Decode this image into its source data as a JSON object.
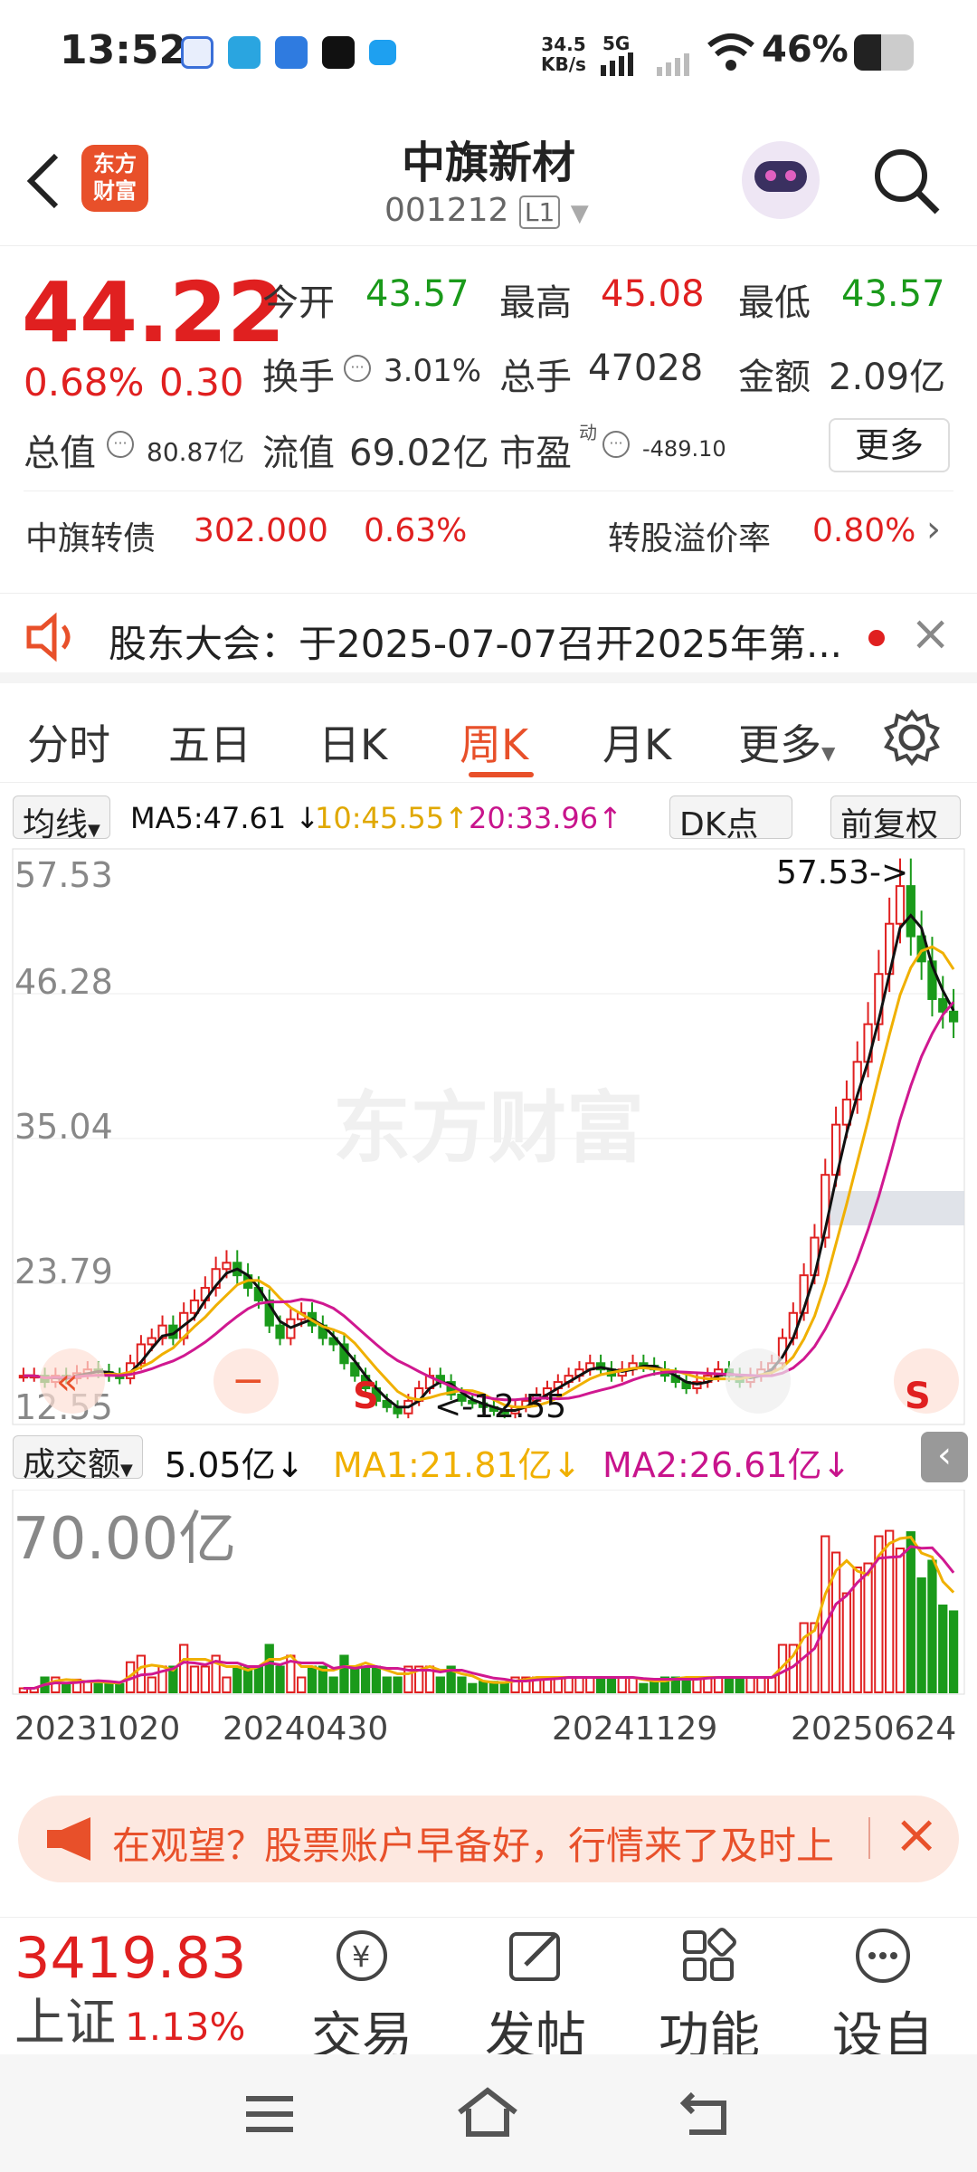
{
  "status": {
    "time": "13:52",
    "net_speed": "34.5",
    "net_unit": "KB/s",
    "net_type": "5G",
    "battery": "46%"
  },
  "header": {
    "title": "中旗新材",
    "code": "001212",
    "level": "L1",
    "logo_text": "东方\n财富"
  },
  "quote": {
    "price": "44.22",
    "change_pct": "0.68%",
    "change": "0.30",
    "open_label": "今开",
    "open": "43.57",
    "high_label": "最高",
    "high": "45.08",
    "low_label": "最低",
    "low": "43.57",
    "turnover_label": "换手",
    "turnover": "3.01%",
    "volume_label": "总手",
    "volume": "47028",
    "amount_label": "金额",
    "amount": "2.09亿",
    "mktcap_label": "总值",
    "mktcap": "80.87亿",
    "float_label": "流值",
    "float": "69.02亿",
    "pe_label": "市盈",
    "pe_sup": "动",
    "pe": "-489.10",
    "more_button": "更多",
    "bond_label": "中旗转债",
    "bond_price": "302.000",
    "bond_pct": "0.63%",
    "premium_label": "转股溢价率",
    "premium": "0.80%"
  },
  "notice": {
    "text": "股东大会：于2025-07-07召开2025年第..."
  },
  "tabs": [
    "分时",
    "五日",
    "日K",
    "周K",
    "月K",
    "更多"
  ],
  "chart_toolbar": {
    "ma_select": "均线",
    "ma5": "MA5:47.61",
    "ma5_arrow": "↓",
    "ma10": "10:45.55",
    "ma10_arrow": "↑",
    "ma20": "20:33.96",
    "ma20_arrow": "↑",
    "dk": "DK点",
    "adjust": "前复权"
  },
  "chart_data": {
    "type": "candlestick",
    "ylim": [
      12.55,
      57.53
    ],
    "y_ticks": [
      "57.53",
      "46.28",
      "35.04",
      "23.79",
      "12.55"
    ],
    "annotation_high": "57.53->",
    "annotation_low": "<-12.55",
    "watermark": "东方财富",
    "ma_colors": {
      "ma5": "#111111",
      "ma10": "#f0b000",
      "ma20": "#d01890"
    },
    "closes": [
      16,
      16,
      15.5,
      16,
      15.8,
      16.2,
      16.5,
      16.3,
      16,
      15.8,
      17,
      18.5,
      19,
      20,
      19,
      21,
      22,
      23,
      24.5,
      25,
      24,
      23,
      22,
      20,
      19,
      20.5,
      21,
      20,
      19,
      18.5,
      17,
      16,
      15,
      14,
      13.5,
      13,
      14,
      15,
      16,
      15.5,
      14.5,
      14,
      13.8,
      13.5,
      13.2,
      13,
      13.5,
      14,
      14.5,
      15,
      15.5,
      16,
      16.5,
      17,
      16.5,
      16,
      16.5,
      17,
      16.8,
      16.5,
      16,
      15.5,
      15,
      15.5,
      16,
      16.5,
      16,
      15.5,
      16,
      16.5,
      17,
      19,
      21,
      24,
      27,
      32,
      36,
      38,
      41,
      44,
      48,
      52,
      55,
      51,
      49,
      46,
      45,
      44.22
    ]
  },
  "volume": {
    "label": "成交额",
    "value": "5.05亿",
    "arrow": "↓",
    "ma1": "MA1:21.81亿",
    "ma1_arrow": "↓",
    "ma2": "MA2:26.61亿",
    "ma2_arrow": "↓",
    "ymax": "70.00亿",
    "dates": [
      "20231020",
      "20240430",
      "20241129",
      "20250624"
    ]
  },
  "ad": {
    "text": "在观望？股票账户早备好，行情来了及时上"
  },
  "bottom_nav": {
    "index_value": "3419.83",
    "index_name": "上证",
    "index_pct": "1.13%",
    "items": [
      "交易",
      "发帖",
      "功能",
      "设自"
    ]
  }
}
